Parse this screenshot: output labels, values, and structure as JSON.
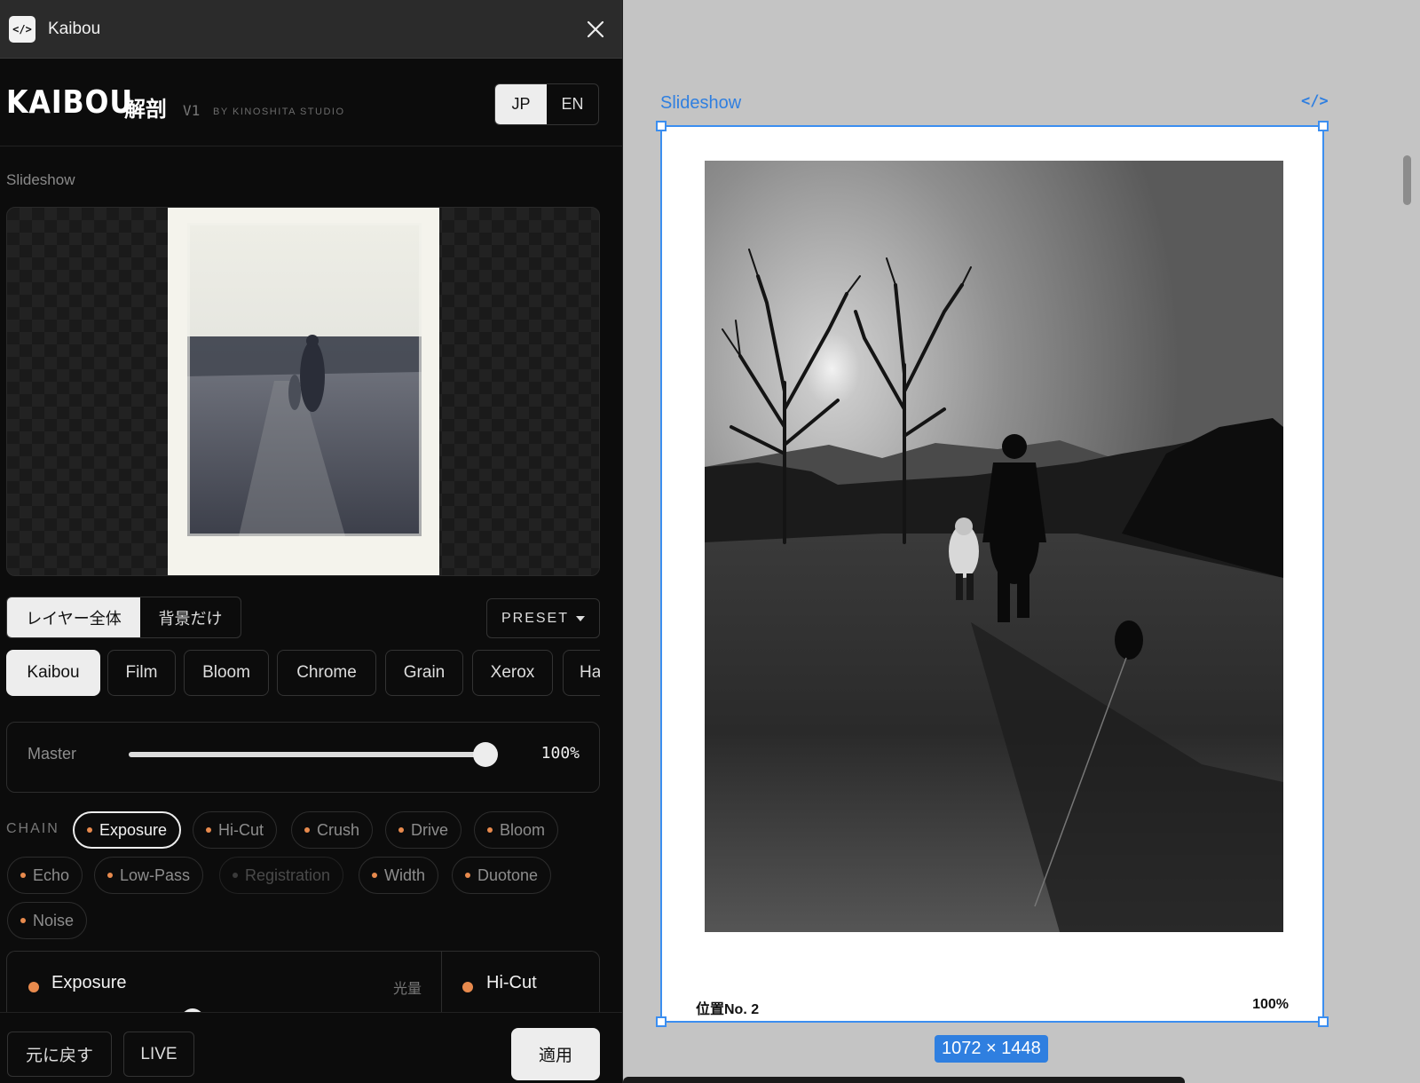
{
  "window": {
    "title": "Kaibou",
    "icon": "code-brackets-icon",
    "close_icon": "close-icon"
  },
  "brand": {
    "name": "KAIBOU",
    "kanji": "解剖",
    "version": "V1",
    "by": "BY KINOSHITA STUDIO"
  },
  "language": {
    "options": [
      "JP",
      "EN"
    ],
    "selected": "JP"
  },
  "layer_name": "Slideshow",
  "scope": {
    "options": [
      "レイヤー全体",
      "背景だけ"
    ],
    "selected": "レイヤー全体"
  },
  "preset_button": "PRESET",
  "presets": [
    "Kaibou",
    "Film",
    "Bloom",
    "Chrome",
    "Grain",
    "Xerox",
    "Ha"
  ],
  "preset_selected": "Kaibou",
  "master": {
    "label": "Master",
    "value_text": "100%",
    "value": 1.0
  },
  "chain": {
    "label": "CHAIN",
    "items": [
      {
        "label": "Exposure",
        "state": "active"
      },
      {
        "label": "Hi-Cut",
        "state": "on"
      },
      {
        "label": "Crush",
        "state": "on"
      },
      {
        "label": "Drive",
        "state": "on"
      },
      {
        "label": "Bloom",
        "state": "on"
      },
      {
        "label": "Echo",
        "state": "on"
      },
      {
        "label": "Low-Pass",
        "state": "on"
      },
      {
        "label": "Registration",
        "state": "disabled"
      },
      {
        "label": "Width",
        "state": "on"
      },
      {
        "label": "Duotone",
        "state": "on"
      },
      {
        "label": "Noise",
        "state": "on"
      }
    ]
  },
  "modules": [
    {
      "name": "Exposure",
      "sub": "光量"
    },
    {
      "name": "Hi-Cut",
      "sub": ""
    }
  ],
  "footer": {
    "revert": "元に戻す",
    "live": "LIVE",
    "apply": "適用"
  },
  "canvas": {
    "frame_label": "Slideshow",
    "code_icon_text": "</>",
    "caption_left": "位置No. 2",
    "caption_right": "100%",
    "size_badge": "1072 × 1448"
  },
  "colors": {
    "accent_orange": "#e88a4d",
    "selection_blue": "#3b8ef0",
    "panel_bg": "#0c0c0c"
  }
}
